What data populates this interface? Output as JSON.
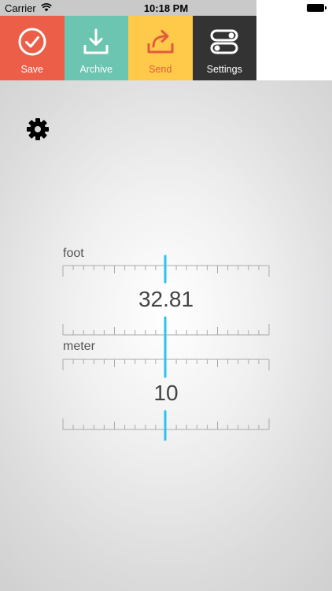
{
  "status_bar": {
    "carrier": "Carrier",
    "time": "10:18 PM",
    "icons": [
      "wifi-icon",
      "battery-icon"
    ]
  },
  "toolbar": {
    "buttons": [
      {
        "label": "Save",
        "icon": "checkmark-circle-icon",
        "color": "#ed5e48"
      },
      {
        "label": "Archive",
        "icon": "download-icon",
        "color": "#6cc5b0"
      },
      {
        "label": "Send",
        "icon": "share-arrow-icon",
        "color": "#ffc94a"
      },
      {
        "label": "Settings",
        "icon": "toggles-icon",
        "color": "#333333"
      }
    ]
  },
  "settings_gear": {
    "icon": "gear-icon"
  },
  "converter": {
    "from": {
      "unit": "foot",
      "value": "32.81"
    },
    "to": {
      "unit": "meter",
      "value": "10"
    },
    "indicator_color": "#27c4ee"
  }
}
